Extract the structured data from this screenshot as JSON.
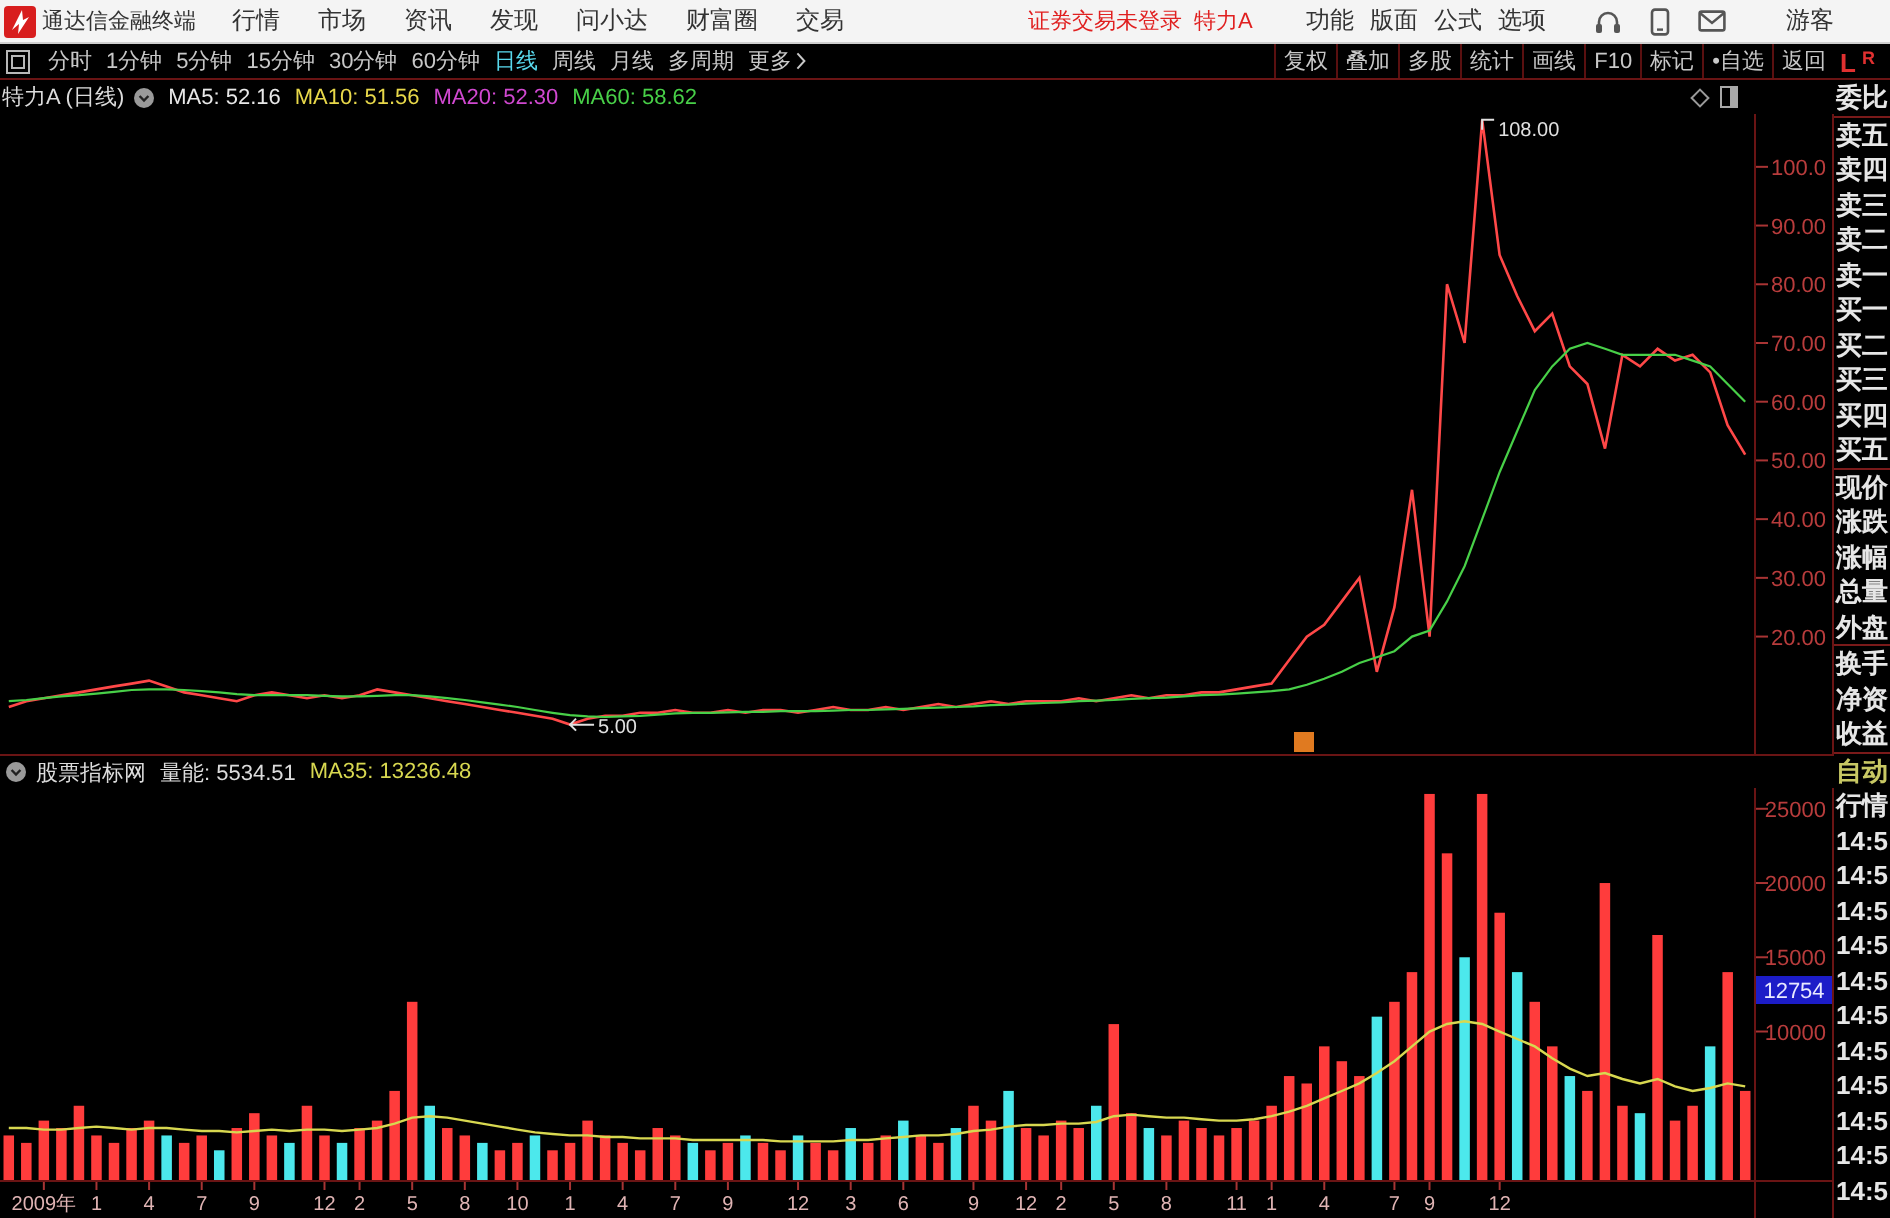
{
  "top_bar": {
    "app_title": "通达信金融终端",
    "menu": [
      "行情",
      "市场",
      "资讯",
      "发现",
      "问小达",
      "财富圈",
      "交易"
    ],
    "login_status": "证券交易未登录",
    "stock": "特力A",
    "actions": [
      "功能",
      "版面",
      "公式",
      "选项"
    ],
    "user": "游客"
  },
  "toolbar": {
    "periods": [
      {
        "label": "分时",
        "selected": false
      },
      {
        "label": "1分钟",
        "selected": false
      },
      {
        "label": "5分钟",
        "selected": false
      },
      {
        "label": "15分钟",
        "selected": false
      },
      {
        "label": "30分钟",
        "selected": false
      },
      {
        "label": "60分钟",
        "selected": false
      },
      {
        "label": "日线",
        "selected": true
      },
      {
        "label": "周线",
        "selected": false
      },
      {
        "label": "月线",
        "selected": false
      },
      {
        "label": "多周期",
        "selected": false
      }
    ],
    "more": "更多",
    "buttons": [
      "复权",
      "叠加",
      "多股",
      "统计",
      "画线",
      "F10",
      "标记",
      "•自选",
      "返回"
    ]
  },
  "price_panel": {
    "title": "特力A (日线)",
    "indicators": [
      {
        "label": "MA5: 52.16",
        "color": "#e8e8e8"
      },
      {
        "label": "MA10: 51.56",
        "color": "#e8d84a"
      },
      {
        "label": "MA20: 52.30",
        "color": "#d048d0"
      },
      {
        "label": "MA60: 58.62",
        "color": "#48d048"
      }
    ],
    "event_marker": true,
    "chart_data": {
      "type": "line",
      "ylim": [
        0,
        109
      ],
      "yticks": [
        {
          "value": 20,
          "label": "20.00"
        },
        {
          "value": 30,
          "label": "30.00"
        },
        {
          "value": 40,
          "label": "40.00"
        },
        {
          "value": 50,
          "label": "50.00"
        },
        {
          "value": 60,
          "label": "60.00"
        },
        {
          "value": 70,
          "label": "70.00"
        },
        {
          "value": 80,
          "label": "80.00"
        },
        {
          "value": 90,
          "label": "90.00"
        },
        {
          "value": 100,
          "label": "100.0"
        }
      ],
      "series": [
        {
          "color": "#ff4848",
          "values": [
            8,
            9,
            9.5,
            10,
            10.5,
            11,
            11.5,
            12,
            12.5,
            11.5,
            10.5,
            10,
            9.5,
            9,
            10,
            10.5,
            10,
            9.5,
            10,
            9.5,
            10,
            11,
            10.5,
            10,
            9.5,
            9,
            8.5,
            8,
            7.5,
            7,
            6.5,
            6,
            5,
            6,
            6.5,
            6.5,
            7,
            7,
            7.5,
            7,
            7,
            7.5,
            7,
            7.5,
            7.5,
            7,
            7.5,
            8,
            7.5,
            7.5,
            8,
            7.5,
            8,
            8.5,
            8,
            8.5,
            9,
            8.5,
            9,
            9,
            9,
            9.5,
            9,
            9.5,
            10,
            9.5,
            10,
            10,
            10.5,
            10.5,
            11,
            11.5,
            12,
            16,
            20,
            22,
            26,
            30,
            14,
            25,
            45,
            20,
            80,
            70,
            108,
            85,
            78,
            72,
            75,
            66,
            63,
            52,
            68,
            66,
            69,
            67,
            68,
            65,
            56,
            51
          ]
        },
        {
          "color": "#48d048",
          "values": [
            9,
            9.2,
            9.5,
            9.8,
            10,
            10.3,
            10.6,
            10.9,
            11,
            11,
            10.9,
            10.7,
            10.5,
            10.2,
            10,
            10,
            10,
            10,
            9.9,
            9.8,
            9.8,
            9.9,
            10,
            10,
            9.8,
            9.5,
            9.2,
            8.8,
            8.4,
            8,
            7.5,
            7,
            6.6,
            6.4,
            6.3,
            6.4,
            6.5,
            6.7,
            6.9,
            7,
            7,
            7.1,
            7.2,
            7.2,
            7.3,
            7.3,
            7.3,
            7.4,
            7.5,
            7.5,
            7.6,
            7.7,
            7.8,
            7.9,
            8,
            8.1,
            8.3,
            8.4,
            8.6,
            8.7,
            8.8,
            9,
            9.1,
            9.2,
            9.4,
            9.5,
            9.6,
            9.8,
            10,
            10.1,
            10.3,
            10.5,
            10.7,
            11,
            11.8,
            12.8,
            14,
            15.5,
            16.5,
            17.5,
            20,
            21,
            26,
            32,
            40,
            48,
            55,
            62,
            66,
            69,
            70,
            69,
            68,
            68,
            68,
            68,
            67,
            66,
            63,
            60
          ]
        }
      ],
      "annotations": [
        "108.00",
        "5.00"
      ]
    }
  },
  "volume_panel": {
    "title": "股票指标网",
    "reading": "量能: 5534.51",
    "indicators": [
      {
        "label": "MA35: 13236.48",
        "color": "#d8d850"
      }
    ],
    "current_value": "12754",
    "chart_data": {
      "type": "bar",
      "categories": [
        null,
        null,
        "2009年",
        null,
        null,
        "1",
        null,
        null,
        "4",
        null,
        null,
        "7",
        null,
        null,
        "9",
        null,
        null,
        null,
        "12",
        null,
        "2",
        null,
        null,
        "5",
        null,
        null,
        "8",
        null,
        null,
        "10",
        null,
        null,
        "1",
        null,
        null,
        "4",
        null,
        null,
        "7",
        null,
        null,
        "9",
        null,
        null,
        null,
        "12",
        null,
        null,
        "3",
        null,
        null,
        "6",
        null,
        null,
        null,
        "9",
        null,
        null,
        "12",
        null,
        "2",
        null,
        null,
        "5",
        null,
        null,
        "8",
        null,
        null,
        null,
        "11",
        null,
        "1",
        null,
        null,
        "4",
        null,
        null,
        null,
        "7",
        null,
        "9",
        null,
        null,
        null,
        "12",
        null,
        null,
        null,
        null,
        null,
        null,
        null,
        null,
        null,
        null,
        null,
        null,
        null,
        null
      ],
      "ylim": [
        0,
        26400
      ],
      "yticks": [
        {
          "value": 10000,
          "label": "10000"
        },
        {
          "value": 15000,
          "label": "15000"
        },
        {
          "value": 20000,
          "label": "20000"
        },
        {
          "value": 25000,
          "label": "25000"
        }
      ],
      "series": [
        {
          "values": [
            3000,
            2500,
            4000,
            3500,
            5000,
            3000,
            2500,
            3500,
            4000,
            3000,
            2500,
            3000,
            2000,
            3500,
            4500,
            3000,
            2500,
            5000,
            3000,
            2500,
            3500,
            4000,
            6000,
            12000,
            5000,
            3500,
            3000,
            2500,
            2000,
            2500,
            3000,
            2000,
            2500,
            4000,
            3000,
            2500,
            2000,
            3500,
            3000,
            2500,
            2000,
            2500,
            3000,
            2500,
            2000,
            3000,
            2500,
            2000,
            3500,
            2500,
            3000,
            4000,
            3000,
            2500,
            3500,
            5000,
            4000,
            6000,
            3500,
            3000,
            4000,
            3500,
            5000,
            10500,
            4500,
            3500,
            3000,
            4000,
            3500,
            3000,
            3500,
            4000,
            5000,
            7000,
            6500,
            9000,
            8000,
            7000,
            11000,
            12000,
            14000,
            26000,
            22000,
            15000,
            26000,
            18000,
            14000,
            12000,
            9000,
            7000,
            6000,
            20000,
            5000,
            4500,
            16500,
            4000,
            5000,
            9000,
            14000,
            6000
          ],
          "colors": [
            "#ff3c3c",
            "#ff3c3c",
            "#ff3c3c",
            "#ff3c3c",
            "#ff3c3c",
            "#ff3c3c",
            "#ff3c3c",
            "#ff3c3c",
            "#ff3c3c",
            "#4ce8ec",
            "#ff3c3c",
            "#ff3c3c",
            "#4ce8ec",
            "#ff3c3c",
            "#ff3c3c",
            "#ff3c3c",
            "#4ce8ec",
            "#ff3c3c",
            "#ff3c3c",
            "#4ce8ec",
            "#ff3c3c",
            "#ff3c3c",
            "#ff3c3c",
            "#ff3c3c",
            "#4ce8ec",
            "#ff3c3c",
            "#ff3c3c",
            "#4ce8ec",
            "#ff3c3c",
            "#ff3c3c",
            "#4ce8ec",
            "#ff3c3c",
            "#ff3c3c",
            "#ff3c3c",
            "#ff3c3c",
            "#ff3c3c",
            "#ff3c3c",
            "#ff3c3c",
            "#ff3c3c",
            "#4ce8ec",
            "#ff3c3c",
            "#ff3c3c",
            "#4ce8ec",
            "#ff3c3c",
            "#ff3c3c",
            "#4ce8ec",
            "#ff3c3c",
            "#ff3c3c",
            "#4ce8ec",
            "#ff3c3c",
            "#ff3c3c",
            "#4ce8ec",
            "#ff3c3c",
            "#ff3c3c",
            "#4ce8ec",
            "#ff3c3c",
            "#ff3c3c",
            "#4ce8ec",
            "#ff3c3c",
            "#ff3c3c",
            "#ff3c3c",
            "#ff3c3c",
            "#4ce8ec",
            "#ff3c3c",
            "#ff3c3c",
            "#4ce8ec",
            "#ff3c3c",
            "#ff3c3c",
            "#ff3c3c",
            "#ff3c3c",
            "#ff3c3c",
            "#ff3c3c",
            "#ff3c3c",
            "#ff3c3c",
            "#ff3c3c",
            "#ff3c3c",
            "#ff3c3c",
            "#ff3c3c",
            "#4ce8ec",
            "#ff3c3c",
            "#ff3c3c",
            "#ff3c3c",
            "#ff3c3c",
            "#4ce8ec",
            "#ff3c3c",
            "#ff3c3c",
            "#4ce8ec",
            "#ff3c3c",
            "#ff3c3c",
            "#4ce8ec",
            "#ff3c3c",
            "#ff3c3c",
            "#ff3c3c",
            "#4ce8ec",
            "#ff3c3c",
            "#ff3c3c",
            "#ff3c3c",
            "#4ce8ec",
            "#ff3c3c",
            "#ff3c3c"
          ]
        },
        {
          "type": "line",
          "color": "#d8d850",
          "values": [
            3500,
            3500,
            3400,
            3400,
            3500,
            3600,
            3500,
            3400,
            3500,
            3500,
            3400,
            3300,
            3300,
            3200,
            3300,
            3400,
            3300,
            3400,
            3400,
            3300,
            3400,
            3500,
            3800,
            4200,
            4300,
            4200,
            4000,
            3800,
            3600,
            3400,
            3200,
            3100,
            3000,
            3000,
            2900,
            2900,
            2800,
            2800,
            2800,
            2700,
            2700,
            2700,
            2700,
            2700,
            2600,
            2600,
            2600,
            2600,
            2700,
            2700,
            2800,
            2900,
            3000,
            3000,
            3100,
            3300,
            3400,
            3600,
            3700,
            3700,
            3800,
            3800,
            3900,
            4300,
            4400,
            4300,
            4200,
            4200,
            4100,
            4000,
            4000,
            4100,
            4300,
            4600,
            5000,
            5500,
            6000,
            6500,
            7200,
            8000,
            9000,
            10000,
            10500,
            10700,
            10500,
            10000,
            9500,
            9000,
            8200,
            7500,
            7000,
            7200,
            6800,
            6500,
            6800,
            6300,
            6000,
            6200,
            6500,
            6300
          ]
        }
      ]
    }
  },
  "sidebar": {
    "corner": {
      "left": "L",
      "right": "R"
    },
    "groups": [
      {
        "items": [
          {
            "label": "委比"
          }
        ]
      },
      {
        "items": [
          {
            "label": "卖五"
          },
          {
            "label": "卖四"
          },
          {
            "label": "卖三"
          },
          {
            "label": "卖二"
          },
          {
            "label": "卖一"
          },
          {
            "label": "买一"
          },
          {
            "label": "买二"
          },
          {
            "label": "买三"
          },
          {
            "label": "买四"
          },
          {
            "label": "买五"
          }
        ]
      },
      {
        "items": [
          {
            "label": "现价"
          },
          {
            "label": "涨跌"
          },
          {
            "label": "涨幅"
          },
          {
            "label": "总量"
          },
          {
            "label": "外盘"
          }
        ]
      },
      {
        "items": [
          {
            "label": "换手"
          },
          {
            "label": "净资"
          },
          {
            "label": "收益"
          }
        ]
      },
      {
        "items": [
          {
            "label": "自动",
            "color": "#c8c864"
          },
          {
            "label": "行情",
            "color": "#e6e6e6"
          },
          {
            "label": "14:5",
            "color": "#e6e6e6"
          },
          {
            "label": "14:5",
            "color": "#e6e6e6"
          },
          {
            "label": "14:5",
            "color": "#e6e6e6"
          },
          {
            "label": "14:5",
            "color": "#e6e6e6"
          },
          {
            "label": "14:5",
            "color": "#e6e6e6"
          },
          {
            "label": "14:5",
            "color": "#e6e6e6"
          },
          {
            "label": "14:5",
            "color": "#e6e6e6"
          },
          {
            "label": "14:5",
            "color": "#e6e6e6"
          },
          {
            "label": "14:5",
            "color": "#e6e6e6"
          },
          {
            "label": "14:5",
            "color": "#e6e6e6"
          },
          {
            "label": "14:5",
            "color": "#e6e6e6"
          }
        ]
      }
    ]
  }
}
